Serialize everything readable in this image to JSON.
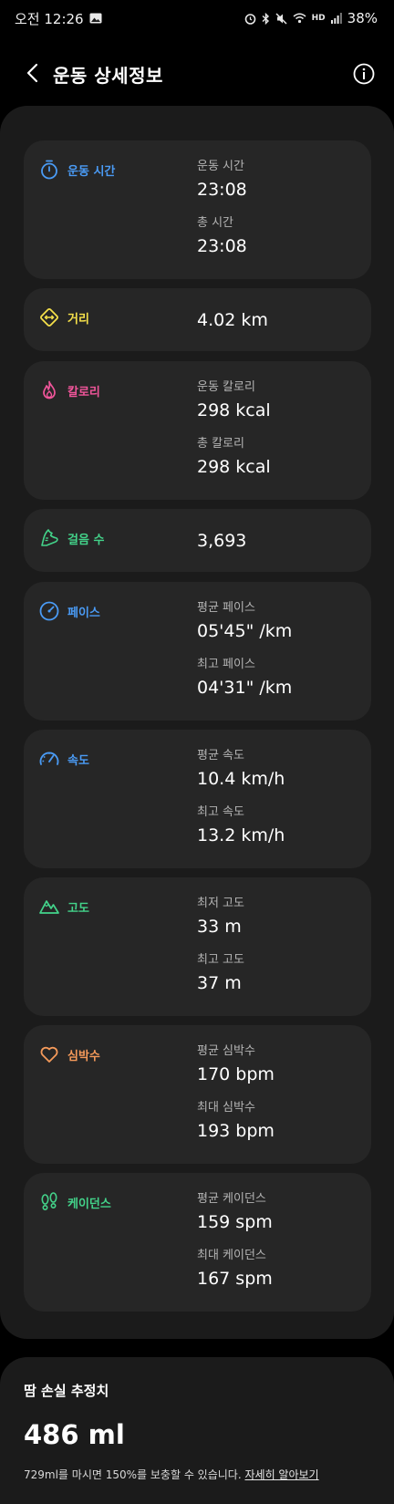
{
  "status_bar": {
    "time": "오전 12:26",
    "battery": "38%",
    "hd_label": "HD"
  },
  "header": {
    "title": "운동 상세정보"
  },
  "colors": {
    "duration": "#4a9bf5",
    "distance": "#f5e04a",
    "calories": "#f0559a",
    "steps": "#43d38a",
    "pace": "#4a9bf5",
    "speed": "#4a9bf5",
    "altitude": "#43d38a",
    "heart": "#f59a5a",
    "cadence": "#43d38a"
  },
  "cards": {
    "duration": {
      "label": "운동 시간",
      "m1_label": "운동 시간",
      "m1_value": "23:08",
      "m2_label": "총 시간",
      "m2_value": "23:08"
    },
    "distance": {
      "label": "거리",
      "value": "4.02 km"
    },
    "calories": {
      "label": "칼로리",
      "m1_label": "운동 칼로리",
      "m1_value": "298 kcal",
      "m2_label": "총 칼로리",
      "m2_value": "298 kcal"
    },
    "steps": {
      "label": "걸음 수",
      "value": "3,693"
    },
    "pace": {
      "label": "페이스",
      "m1_label": "평균 페이스",
      "m1_value": "05'45\" /km",
      "m2_label": "최고 페이스",
      "m2_value": "04'31\" /km"
    },
    "speed": {
      "label": "속도",
      "m1_label": "평균 속도",
      "m1_value": "10.4 km/h",
      "m2_label": "최고 속도",
      "m2_value": "13.2 km/h"
    },
    "altitude": {
      "label": "고도",
      "m1_label": "최저 고도",
      "m1_value": "33 m",
      "m2_label": "최고 고도",
      "m2_value": "37 m"
    },
    "heart_rate": {
      "label": "심박수",
      "m1_label": "평균 심박수",
      "m1_value": "170 bpm",
      "m2_label": "최대 심박수",
      "m2_value": "193 bpm"
    },
    "cadence": {
      "label": "케이던스",
      "m1_label": "평균 케이던스",
      "m1_value": "159 spm",
      "m2_label": "최대 케이던스",
      "m2_value": "167 spm"
    }
  },
  "sweat": {
    "title": "땀 손실 추정치",
    "value": "486 ml",
    "note": "729ml를 마시면 150%를 보충할 수 있습니다.",
    "link": "자세히 알아보기"
  }
}
